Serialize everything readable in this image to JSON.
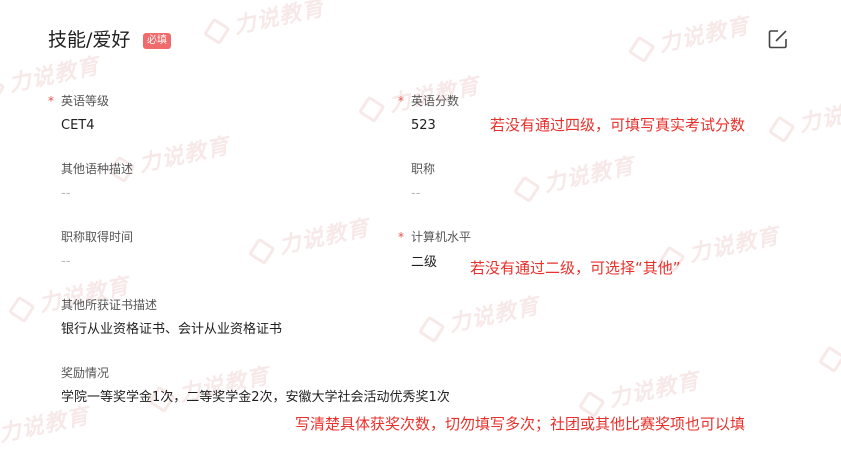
{
  "section": {
    "title": "技能/爱好",
    "required_badge": "必填"
  },
  "watermark": {
    "text": "力说教育"
  },
  "fields": {
    "english_level": {
      "label": "英语等级",
      "value": "CET4",
      "required": "*"
    },
    "english_score": {
      "label": "英语分数",
      "value": "523",
      "required": "*"
    },
    "other_language": {
      "label": "其他语种描述",
      "value": "--"
    },
    "job_title": {
      "label": "职称",
      "value": "--"
    },
    "title_date": {
      "label": "职称取得时间",
      "value": "--"
    },
    "computer_level": {
      "label": "计算机水平",
      "value": "二级",
      "required": "*"
    },
    "other_certs": {
      "label": "其他所获证书描述",
      "value": "银行从业资格证书、会计从业资格证书"
    },
    "awards": {
      "label": "奖励情况",
      "value": "学院一等奖学金1次，二等奖学金2次，安徽大学社会活动优秀奖1次"
    }
  },
  "annotations": {
    "english_score_note": "若没有通过四级，可填写真实考试分数",
    "computer_note": "若没有通过二级，可选择“其他”",
    "awards_note": "写清楚具体获奖次数，切勿填写多次；社团或其他比赛奖项也可以填"
  },
  "colors": {
    "badge": "#f06b6b",
    "required": "#e5534b",
    "annotation": "#e8312c"
  },
  "icons": {
    "edit": "edit-icon"
  }
}
